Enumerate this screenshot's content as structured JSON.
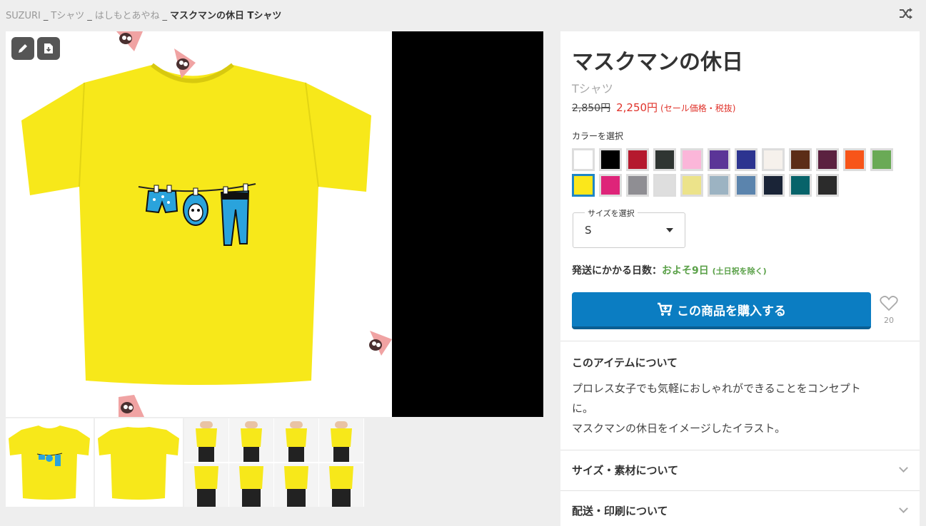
{
  "breadcrumb": {
    "items": [
      "SUZURI",
      "Tシャツ",
      "はしもとあやね"
    ],
    "separator": "_",
    "current": "マスクマンの休日 Tシャツ"
  },
  "toolbar": {
    "edit_icon": "pencil-icon",
    "download_icon": "download-icon",
    "shuffle_icon": "shuffle-icon"
  },
  "product": {
    "title": "マスクマンの休日",
    "type": "Tシャツ",
    "original_price": "2,850円",
    "sale_price": "2,250円",
    "sale_note": "(セール価格・税抜)",
    "body_color": "#f7e81a"
  },
  "color_select": {
    "label": "カラーを選択",
    "selected_index": 12,
    "swatches": [
      "#ffffff",
      "#000000",
      "#b5192e",
      "#2f3532",
      "#fbb6d9",
      "#5b3597",
      "#2c3490",
      "#f6f1ec",
      "#5c2d17",
      "#5b2140",
      "#f75519",
      "#6aaa56",
      "#fbe71b",
      "#de2479",
      "#8f8e93",
      "#dedede",
      "#ece38a",
      "#9cb3c2",
      "#5b84ad",
      "#1a2437",
      "#07636a",
      "#2b2b2b"
    ]
  },
  "size_select": {
    "legend": "サイズを選択",
    "value": "S"
  },
  "shipping": {
    "label": "発送にかかる日数：",
    "days": "およそ9日",
    "note": "(土日祝を除く)"
  },
  "buy": {
    "label": "この商品を購入する"
  },
  "favorite": {
    "count": "20"
  },
  "about": {
    "title": "このアイテムについて",
    "line1": "プロレス女子でも気軽におしゃれができることをコンセプト",
    "line2": "に。",
    "line3": "マスクマンの休日をイメージしたイラスト。"
  },
  "accordions": {
    "size_material": "サイズ・素材について",
    "shipping_print": "配送・印刷について"
  }
}
